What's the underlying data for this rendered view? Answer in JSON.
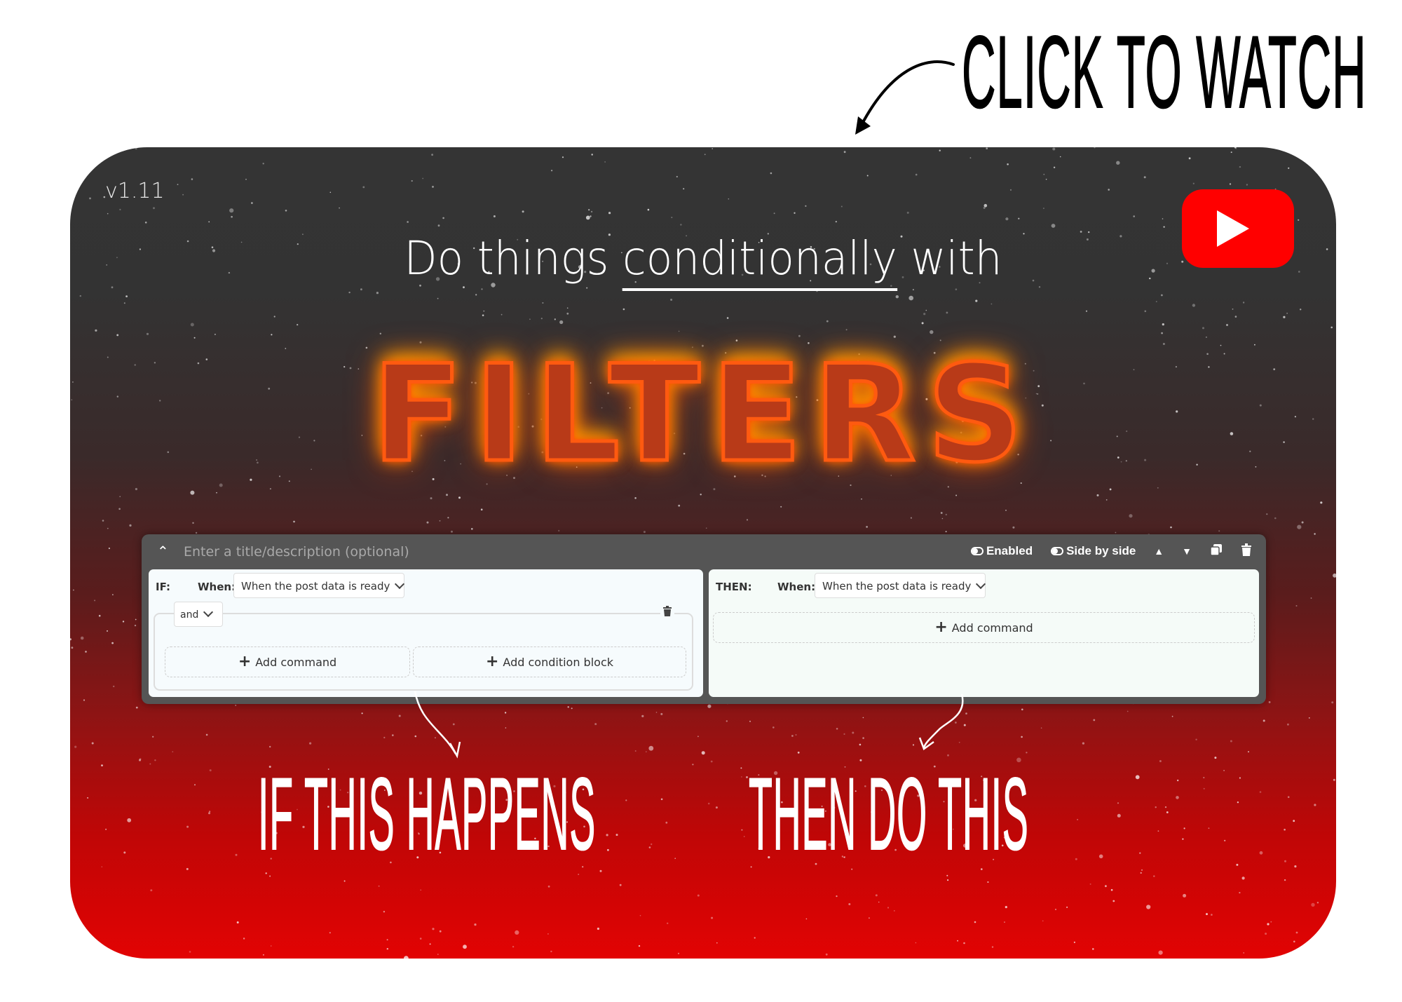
{
  "annotation": {
    "call_to_action": "CLICK TO WATCH",
    "bottom_left": "IF THIS HAPPENS",
    "bottom_right": "THEN DO THIS"
  },
  "card": {
    "version": "v1.11",
    "headline_prefix": "Do things ",
    "headline_emphasis": "conditionally",
    "headline_suffix": " with",
    "feature_title": "FILTERS",
    "play_icon": "youtube-play-icon"
  },
  "filter_editor": {
    "title_placeholder": "Enter a title/description (optional)",
    "title_value": "",
    "toolbar": {
      "enabled_label": "Enabled",
      "side_by_side_label": "Side by side",
      "move_up_icon": "triangle-up-icon",
      "move_down_icon": "triangle-down-icon",
      "duplicate_icon": "copy-icon",
      "delete_icon": "trash-icon"
    },
    "if_section": {
      "label": "IF:",
      "when_label": "When:",
      "when_value": "When the post data is ready",
      "group_operator": "and",
      "add_command_label": "Add command",
      "add_condition_block_label": "Add condition block"
    },
    "then_section": {
      "label": "THEN:",
      "when_label": "When:",
      "when_value": "When the post data is ready",
      "add_command_label": "Add command"
    }
  },
  "colors": {
    "youtube_red": "#ff0000",
    "panel_gray": "#555555",
    "bottom_red": "#e20303"
  }
}
